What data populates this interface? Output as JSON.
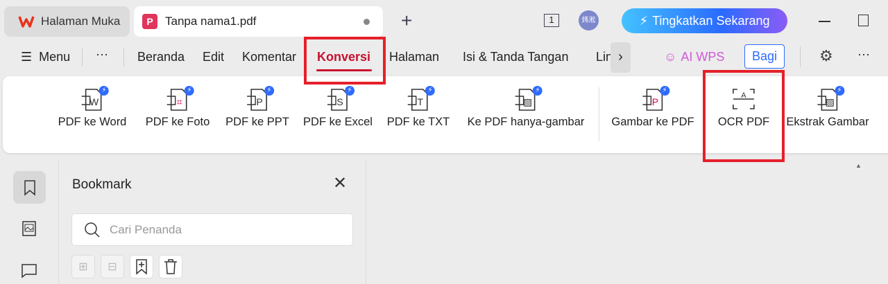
{
  "tabs": [
    {
      "label": "Halaman Muka"
    },
    {
      "label": "Tanpa nama1.pdf"
    }
  ],
  "titlebar": {
    "page_count": "1",
    "avatar": "炜淞",
    "upgrade": "Tingkatkan Sekarang"
  },
  "menu": {
    "menu_label": "Menu",
    "items": [
      "Beranda",
      "Edit",
      "Komentar",
      "Konversi",
      "Halaman",
      "Isi & Tanda Tangan",
      "Lindungi"
    ],
    "active": "Konversi",
    "ai": "AI WPS",
    "share": "Bagi"
  },
  "ribbon": [
    "PDF ke Word",
    "PDF ke Foto",
    "PDF ke PPT",
    "PDF ke Excel",
    "PDF ke TXT",
    "Ke PDF hanya-gambar",
    "Gambar ke PDF",
    "OCR PDF",
    "Ekstrak Gambar"
  ],
  "bookmark": {
    "title": "Bookmark",
    "search_placeholder": "Cari Penanda"
  },
  "colors": {
    "accent": "#c8102e",
    "highlight": "#e5202a",
    "upgrade_start": "#44c2ff",
    "upgrade_end": "#8b5cf6"
  }
}
